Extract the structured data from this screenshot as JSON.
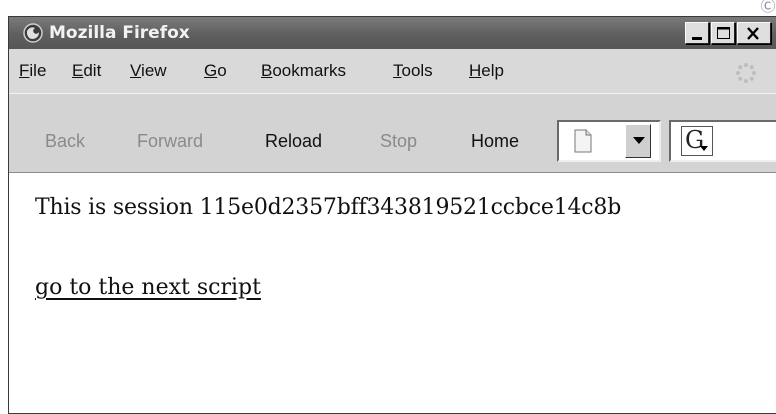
{
  "window": {
    "title": "Mozilla Firefox",
    "caption_buttons": [
      "minimize",
      "maximize",
      "close"
    ]
  },
  "menu": [
    "File",
    "Edit",
    "View",
    "Go",
    "Bookmarks",
    "Tools",
    "Help"
  ],
  "menu_access_keys": [
    "F",
    "E",
    "V",
    "G",
    "B",
    "T",
    "H"
  ],
  "toolbar": {
    "back": "Back",
    "forward": "Forward",
    "reload": "Reload",
    "stop": "Stop",
    "home": "Home",
    "search_engine_glyph": "G"
  },
  "icons": [
    "firefox-icon",
    "throbber-icon",
    "page-icon",
    "dropdown-arrow-icon",
    "search-engine-icon"
  ],
  "content": {
    "session_line": "This is session 115e0d2357bff343819521ccbce14c8b",
    "link_text": "go to the next script"
  }
}
